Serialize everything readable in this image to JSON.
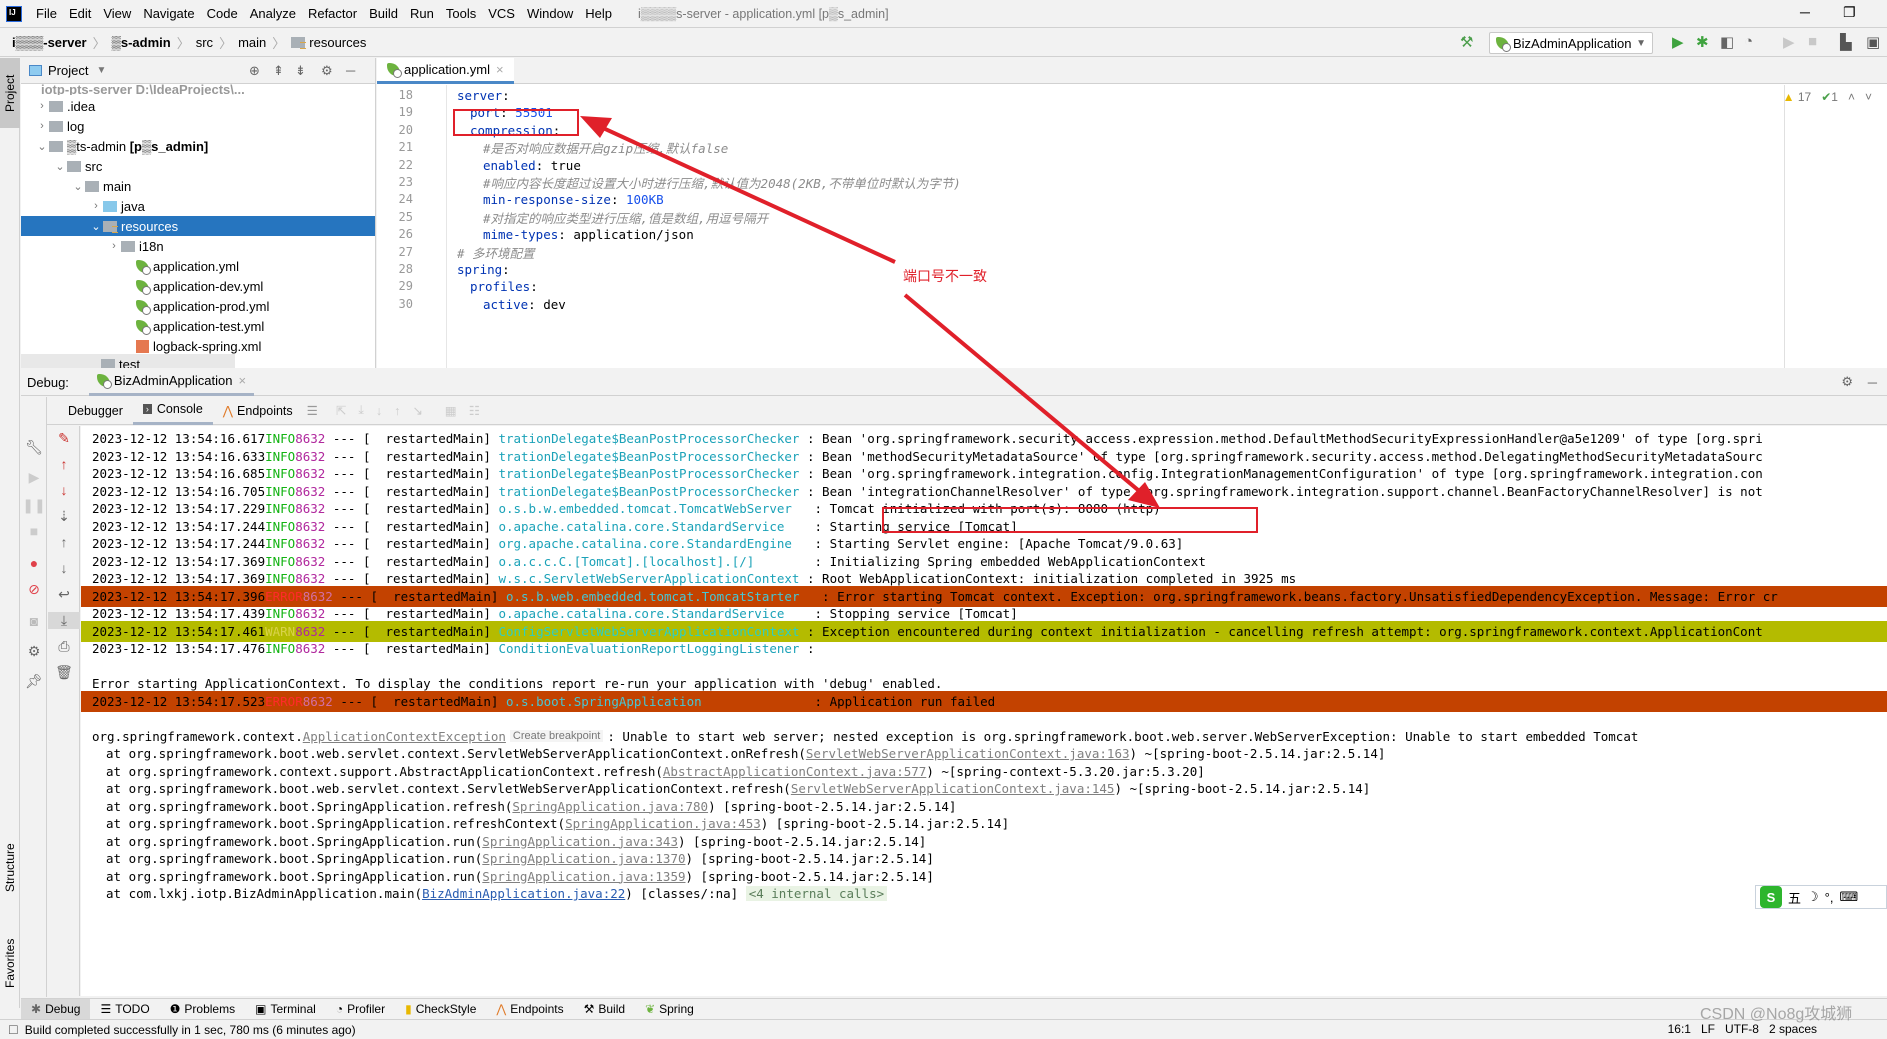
{
  "menubar": {
    "items": [
      "File",
      "Edit",
      "View",
      "Navigate",
      "Code",
      "Analyze",
      "Refactor",
      "Build",
      "Run",
      "Tools",
      "VCS",
      "Window",
      "Help"
    ],
    "window_title": "i▒▒▒▒s-server - application.yml [p▒s_admin]"
  },
  "navbar": {
    "crumbs": [
      "i▒▒▒-server",
      "▒s-admin",
      "src",
      "main",
      "resources"
    ]
  },
  "toolbar": {
    "run_config": "BizAdminApplication"
  },
  "left_strip": {
    "project_tab": "Project",
    "structure_tab": "Structure",
    "favorites_tab": "Favorites"
  },
  "project_panel": {
    "title": "Project",
    "root_label": "iotp-pts-server  D:\\IdeaProjects\\...",
    "items": [
      {
        "label": ".idea",
        "expanded": false
      },
      {
        "label": "log",
        "expanded": false
      },
      {
        "label": "▒ts-admin",
        "suffix": "[p▒s_admin]",
        "expanded": true
      },
      {
        "label": "src",
        "expanded": true
      },
      {
        "label": "main",
        "expanded": true
      },
      {
        "label": "java",
        "expanded": false
      },
      {
        "label": "resources",
        "expanded": true,
        "selected": true
      },
      {
        "label": "i18n",
        "expanded": false
      },
      {
        "label": "application.yml"
      },
      {
        "label": "application-dev.yml"
      },
      {
        "label": "application-prod.yml"
      },
      {
        "label": "application-test.yml"
      },
      {
        "label": "logback-spring.xml"
      },
      {
        "label": "test"
      }
    ]
  },
  "editor": {
    "tab": "application.yml",
    "inspections": {
      "warnings": "17",
      "typos": "1"
    },
    "lines": [
      {
        "n": "18",
        "indent": 0,
        "key": "server",
        "sep": ":",
        "val": ""
      },
      {
        "n": "19",
        "indent": 1,
        "key": "port",
        "sep": ": ",
        "val": "55501"
      },
      {
        "n": "20",
        "indent": 1,
        "key": "compression",
        "sep": ":",
        "val": ""
      },
      {
        "n": "21",
        "indent": 2,
        "comment": "#是否对响应数据开启gzip压缩,默认false"
      },
      {
        "n": "22",
        "indent": 2,
        "key": "enabled",
        "sep": ": ",
        "val": "true"
      },
      {
        "n": "23",
        "indent": 2,
        "comment": "#响应内容长度超过设置大小时进行压缩,默认值为2048(2KB,不带单位时默认为字节)"
      },
      {
        "n": "24",
        "indent": 2,
        "key": "min-response-size",
        "sep": ": ",
        "val": "100KB"
      },
      {
        "n": "25",
        "indent": 2,
        "comment": "#对指定的响应类型进行压缩,值是数组,用逗号隔开"
      },
      {
        "n": "26",
        "indent": 2,
        "key": "mime-types",
        "sep": ": ",
        "val": "application/json"
      },
      {
        "n": "27",
        "indent": 0,
        "comment": "# 多环境配置"
      },
      {
        "n": "28",
        "indent": 0,
        "key": "spring",
        "sep": ":",
        "val": ""
      },
      {
        "n": "29",
        "indent": 1,
        "key": "profiles",
        "sep": ":",
        "val": ""
      },
      {
        "n": "30",
        "indent": 2,
        "key": "active",
        "sep": ": ",
        "val": "dev"
      }
    ]
  },
  "annotation": {
    "text": "端口号不一致"
  },
  "debug": {
    "label": "Debug:",
    "session_tab": "BizAdminApplication",
    "tabs": [
      "Debugger",
      "Console",
      "Endpoints"
    ],
    "active_tab": "Console"
  },
  "console": {
    "log_lines": [
      {
        "ts": "2023-12-12 13:54:16.617",
        "lvl": "INFO",
        "pid": "8632",
        "thread": "restartedMain",
        "logger": "trationDelegate$BeanPostProcessorChecker",
        "msg": "Bean 'org.springframework.security.access.expression.method.DefaultMethodSecurityExpressionHandler@a5e1209' of type [org.spri"
      },
      {
        "ts": "2023-12-12 13:54:16.633",
        "lvl": "INFO",
        "pid": "8632",
        "thread": "restartedMain",
        "logger": "trationDelegate$BeanPostProcessorChecker",
        "msg": "Bean 'methodSecurityMetadataSource' of type [org.springframework.security.access.method.DelegatingMethodSecurityMetadataSourc"
      },
      {
        "ts": "2023-12-12 13:54:16.685",
        "lvl": "INFO",
        "pid": "8632",
        "thread": "restartedMain",
        "logger": "trationDelegate$BeanPostProcessorChecker",
        "msg": "Bean 'org.springframework.integration.config.IntegrationManagementConfiguration' of type [org.springframework.integration.con"
      },
      {
        "ts": "2023-12-12 13:54:16.705",
        "lvl": "INFO",
        "pid": "8632",
        "thread": "restartedMain",
        "logger": "trationDelegate$BeanPostProcessorChecker",
        "msg": "Bean 'integrationChannelResolver' of type [org.springframework.integration.support.channel.BeanFactoryChannelResolver] is not"
      },
      {
        "ts": "2023-12-12 13:54:17.229",
        "lvl": "INFO",
        "pid": "8632",
        "thread": "restartedMain",
        "logger": "o.s.b.w.embedded.tomcat.TomcatWebServer  ",
        "msg": "Tomcat initialized with port(s): 8080 (http)"
      },
      {
        "ts": "2023-12-12 13:54:17.244",
        "lvl": "INFO",
        "pid": "8632",
        "thread": "restartedMain",
        "logger": "o.apache.catalina.core.StandardService   ",
        "msg": "Starting service [Tomcat]"
      },
      {
        "ts": "2023-12-12 13:54:17.244",
        "lvl": "INFO",
        "pid": "8632",
        "thread": "restartedMain",
        "logger": "org.apache.catalina.core.StandardEngine  ",
        "msg": "Starting Servlet engine: [Apache Tomcat/9.0.63]"
      },
      {
        "ts": "2023-12-12 13:54:17.369",
        "lvl": "INFO",
        "pid": "8632",
        "thread": "restartedMain",
        "logger": "o.a.c.c.C.[Tomcat].[localhost].[/]       ",
        "msg": "Initializing Spring embedded WebApplicationContext"
      },
      {
        "ts": "2023-12-12 13:54:17.369",
        "lvl": "INFO",
        "pid": "8632",
        "thread": "restartedMain",
        "logger": "w.s.c.ServletWebServerApplicationContext",
        "msg": "Root WebApplicationContext: initialization completed in 3925 ms"
      },
      {
        "ts": "2023-12-12 13:54:17.396",
        "lvl": "ERROR",
        "pid": "8632",
        "thread": "restartedMain",
        "logger": "o.s.b.web.embedded.tomcat.TomcatStarter  ",
        "msg": "Error starting Tomcat context. Exception: org.springframework.beans.factory.UnsatisfiedDependencyException. Message: Error cr"
      },
      {
        "ts": "2023-12-12 13:54:17.439",
        "lvl": "INFO",
        "pid": "8632",
        "thread": "restartedMain",
        "logger": "o.apache.catalina.core.StandardService   ",
        "msg": "Stopping service [Tomcat]"
      },
      {
        "ts": "2023-12-12 13:54:17.461",
        "lvl": "WARN",
        "pid": "8632",
        "thread": "restartedMain",
        "logger": "ConfigServletWebServerApplicationContext",
        "msg": "Exception encountered during context initialization - cancelling refresh attempt: org.springframework.context.ApplicationCont"
      },
      {
        "ts": "2023-12-12 13:54:17.476",
        "lvl": "INFO",
        "pid": "8632",
        "thread": "restartedMain",
        "logger": "ConditionEvaluationReportLoggingListener",
        "msg": ""
      }
    ],
    "error_banner": "Error starting ApplicationContext. To display the conditions report re-run your application with 'debug' enabled.",
    "fatal_line": {
      "ts": "2023-12-12 13:54:17.523",
      "lvl": "ERROR",
      "pid": "8632",
      "thread": "restartedMain",
      "logger": "o.s.boot.SpringApplication              ",
      "msg": "Application run failed"
    },
    "exception": {
      "prefix": "org.springframework.context.",
      "class_link": "ApplicationContextException",
      "breakpoint_label": "Create breakpoint",
      "message": ": Unable to start web server; nested exception is org.springframework.boot.web.server.WebServerException: Unable to start embedded Tomcat"
    },
    "stack": [
      {
        "at": "at org.springframework.boot.web.servlet.context.ServletWebServerApplicationContext.onRefresh(",
        "link": "ServletWebServerApplicationContext.java:163",
        "tail": ") ~[spring-boot-2.5.14.jar:2.5.14]"
      },
      {
        "at": "at org.springframework.context.support.AbstractApplicationContext.refresh(",
        "link": "AbstractApplicationContext.java:577",
        "tail": ") ~[spring-context-5.3.20.jar:5.3.20]"
      },
      {
        "at": "at org.springframework.boot.web.servlet.context.ServletWebServerApplicationContext.refresh(",
        "link": "ServletWebServerApplicationContext.java:145",
        "tail": ") ~[spring-boot-2.5.14.jar:2.5.14]"
      },
      {
        "at": "at org.springframework.boot.SpringApplication.refresh(",
        "link": "SpringApplication.java:780",
        "tail": ") [spring-boot-2.5.14.jar:2.5.14]"
      },
      {
        "at": "at org.springframework.boot.SpringApplication.refreshContext(",
        "link": "SpringApplication.java:453",
        "tail": ") [spring-boot-2.5.14.jar:2.5.14]"
      },
      {
        "at": "at org.springframework.boot.SpringApplication.run(",
        "link": "SpringApplication.java:343",
        "tail": ") [spring-boot-2.5.14.jar:2.5.14]"
      },
      {
        "at": "at org.springframework.boot.SpringApplication.run(",
        "link": "SpringApplication.java:1370",
        "tail": ") [spring-boot-2.5.14.jar:2.5.14]"
      },
      {
        "at": "at org.springframework.boot.SpringApplication.run(",
        "link": "SpringApplication.java:1359",
        "tail": ") [spring-boot-2.5.14.jar:2.5.14]"
      },
      {
        "at": "at com.lxkj.iotp.BizAdminApplication.main(",
        "link": "BizAdminApplication.java:22",
        "tail": ") [classes/:na] ",
        "internal": "<4 internal calls>"
      }
    ]
  },
  "bottom_tabs": [
    "Debug",
    "TODO",
    "Problems",
    "Terminal",
    "Profiler",
    "CheckStyle",
    "Endpoints",
    "Build",
    "Spring"
  ],
  "status": {
    "message": "Build completed successfully in 1 sec, 780 ms (6 minutes ago)",
    "position": "16:1",
    "line_sep": "LF",
    "encoding": "UTF-8",
    "indent": "2 spaces"
  },
  "ime": {
    "mode": "五"
  },
  "watermark": "CSDN @No8g攻城狮"
}
